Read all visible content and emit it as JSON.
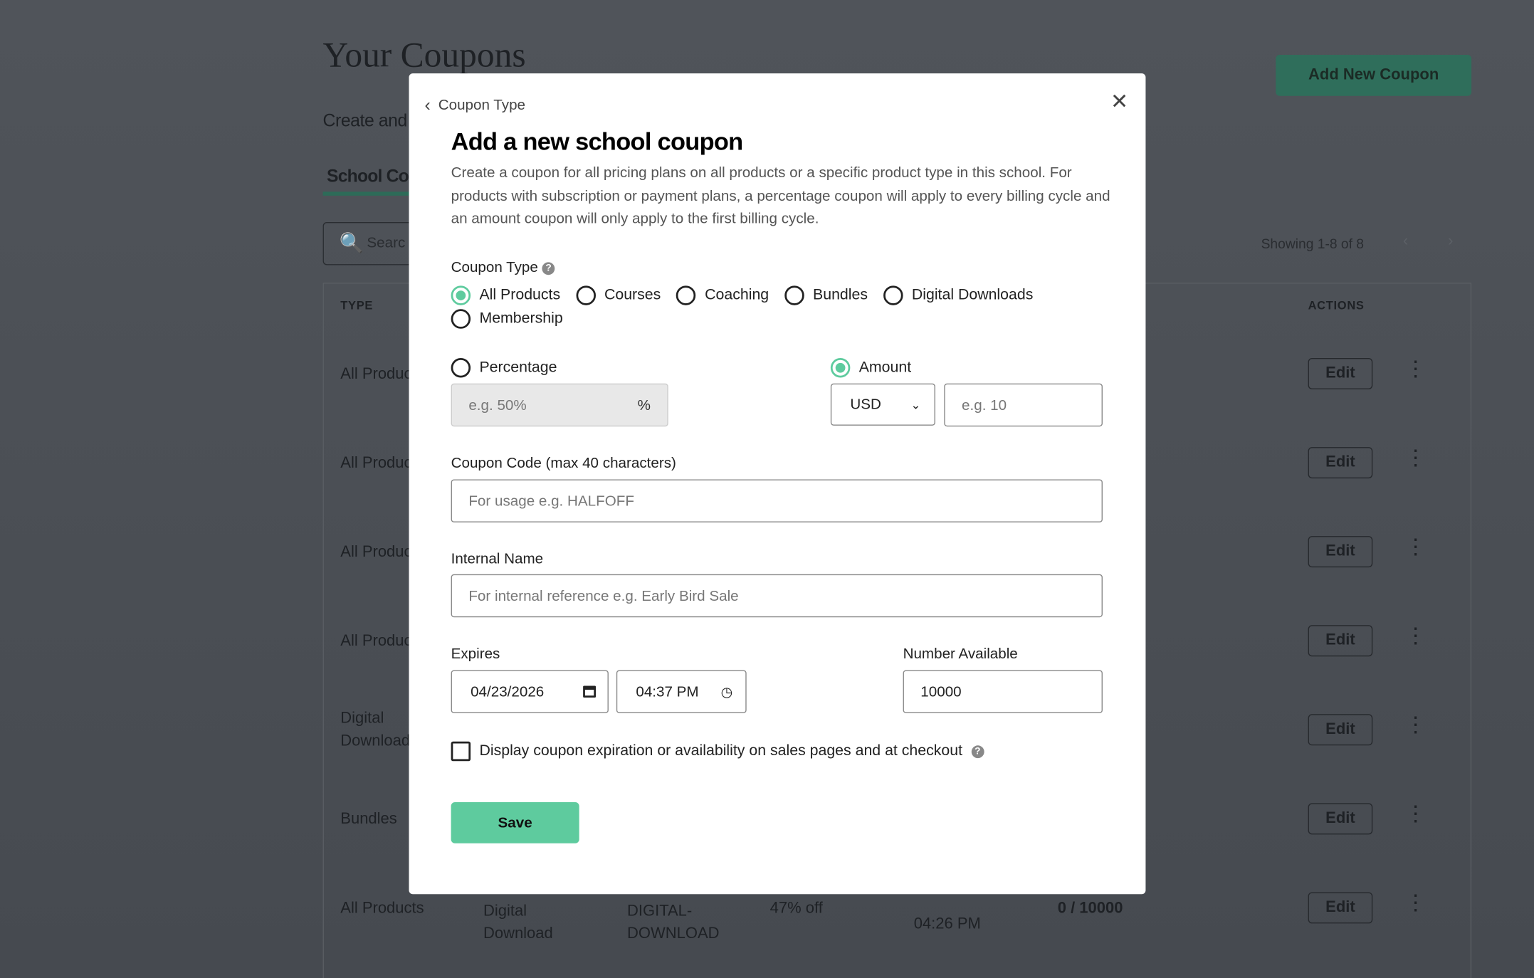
{
  "background": {
    "title": "Your Coupons",
    "subtitle": "Create and",
    "tab": "School Co",
    "search_placeholder": "Searc",
    "add_button": "Add New Coupon",
    "showing": "Showing 1-8 of 8",
    "col_type": "TYPE",
    "col_actions": "ACTIONS",
    "rows": [
      {
        "type": "All Produc"
      },
      {
        "type": "All Produc"
      },
      {
        "type": "All Produc"
      },
      {
        "type": "All Produc"
      },
      {
        "type": "Digital Download"
      },
      {
        "type": "Bundles"
      },
      {
        "type": "All Products",
        "product": "Digital Download",
        "code": "DIGITAL-DOWNLOAD",
        "discount": "47% off",
        "expires_time": "04:26 PM",
        "available": "0 / 10000"
      }
    ],
    "edit_label": "Edit"
  },
  "modal": {
    "back_label": "Coupon Type",
    "title": "Add a new school coupon",
    "description": "Create a coupon for all pricing plans on all products or a specific product type in this school. For products with subscription or payment plans, a percentage coupon will apply to every billing cycle and an amount coupon will only apply to the first billing cycle.",
    "coupon_type_label": "Coupon Type",
    "types": [
      "All Products",
      "Courses",
      "Coaching",
      "Bundles",
      "Digital Downloads",
      "Membership"
    ],
    "selected_type": "All Products",
    "percentage_label": "Percentage",
    "percentage_placeholder": "e.g. 50%",
    "percent_sign": "%",
    "amount_label": "Amount",
    "currency": "USD",
    "amount_placeholder": "e.g. 10",
    "selected_discount": "Amount",
    "code_label": "Coupon Code (max 40 characters)",
    "code_placeholder": "For usage e.g. HALFOFF",
    "name_label": "Internal Name",
    "name_placeholder": "For internal reference e.g. Early Bird Sale",
    "expires_label": "Expires",
    "date_value": "04/23/2026",
    "time_value": "04:37 PM",
    "available_label": "Number Available",
    "available_value": "10000",
    "display_checkbox_label": "Display coupon expiration or availability on sales pages and at checkout",
    "display_checked": false,
    "save_label": "Save"
  },
  "colors": {
    "accent": "#5ecb9e",
    "brand_dark": "#2f6e5b"
  }
}
